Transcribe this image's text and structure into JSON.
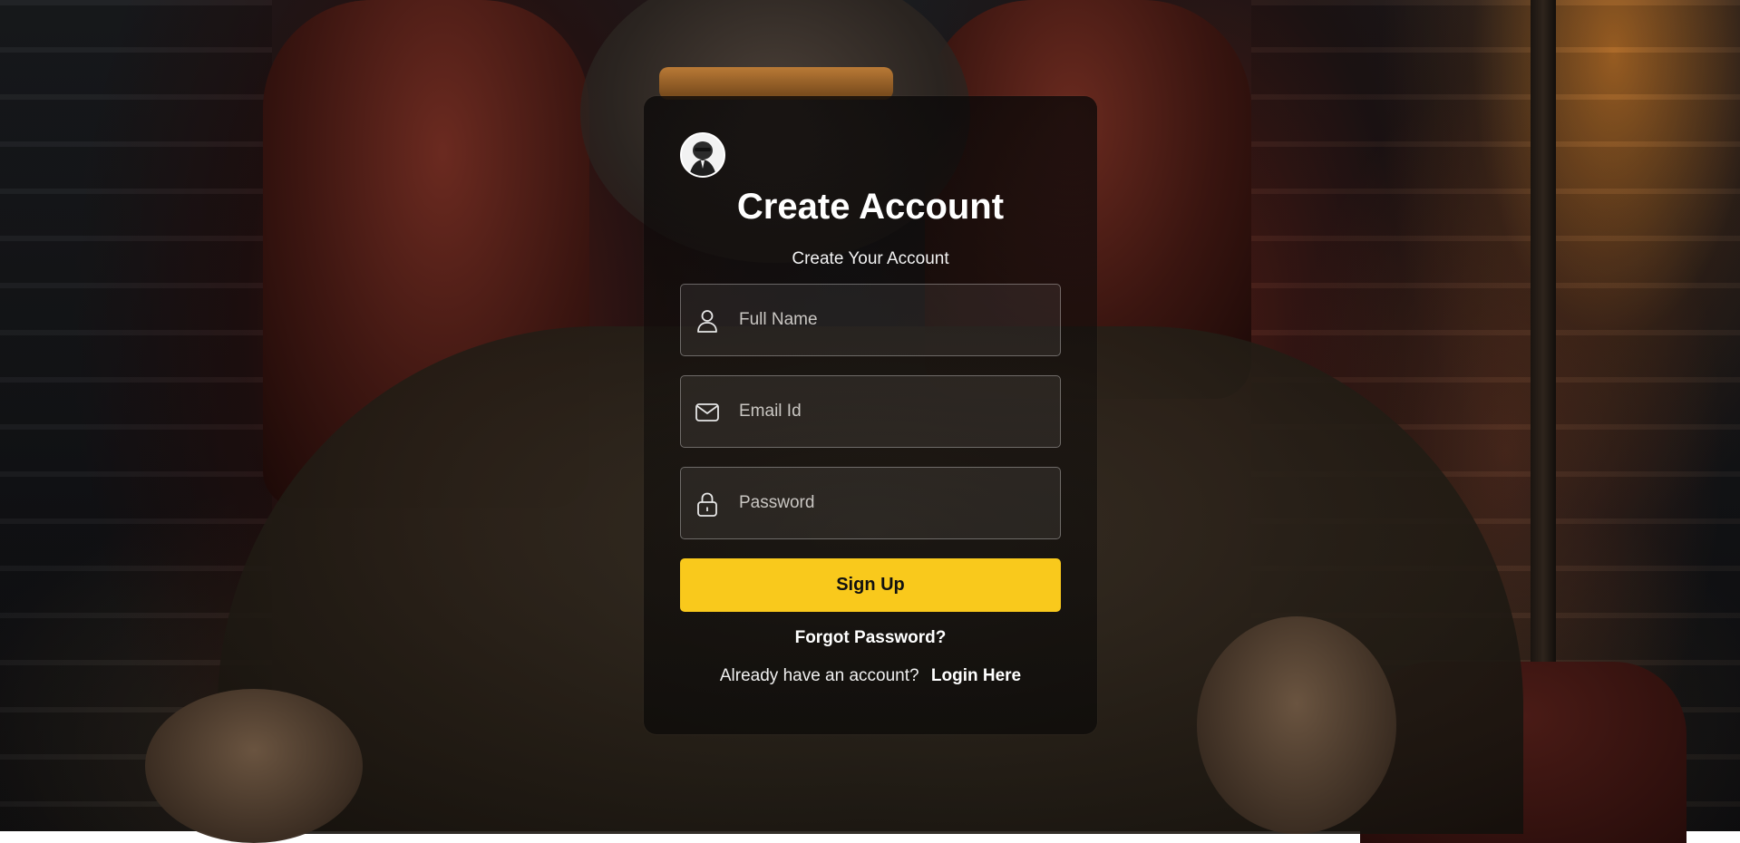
{
  "form": {
    "title": "Create Account",
    "subtitle": "Create Your Account",
    "fields": [
      {
        "placeholder": "Full Name",
        "value": "",
        "icon": "user-icon"
      },
      {
        "placeholder": "Email Id",
        "value": "",
        "icon": "mail-icon"
      },
      {
        "placeholder": "Password",
        "value": "",
        "icon": "lock-icon"
      }
    ],
    "submit_label": "Sign Up",
    "forgot_label": "Forgot Password?",
    "account_prompt": "Already have an account?",
    "login_label": "Login Here"
  },
  "colors": {
    "accent": "#f9c91c",
    "text": "#ffffff",
    "placeholder": "#c9c6c2"
  }
}
